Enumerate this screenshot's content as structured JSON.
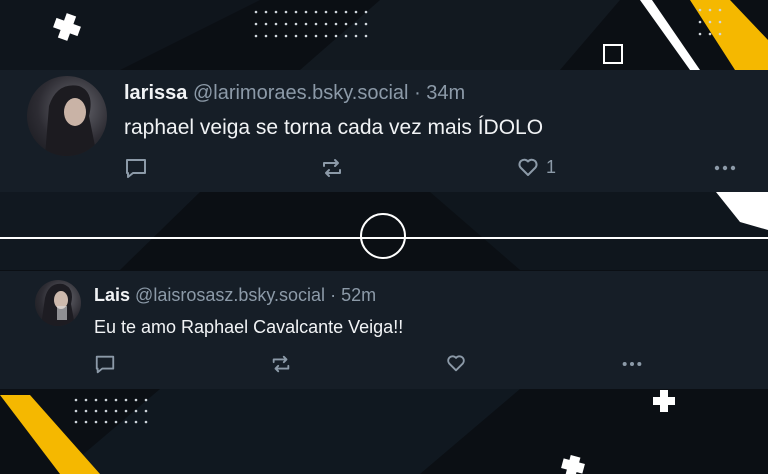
{
  "colors": {
    "background": "#0b0f14",
    "card": "#161e27",
    "accent_yellow": "#f5b800",
    "muted": "#8c9aa8",
    "text": "#f1f3f5"
  },
  "posts": [
    {
      "display_name": "larissa",
      "handle": "@larimoraes.bsky.social",
      "separator": "·",
      "time": "34m",
      "text": "raphael veiga se torna cada vez mais ÍDOLO",
      "like_count": "1",
      "icons": [
        "reply-icon",
        "repost-icon",
        "heart-icon",
        "more-icon"
      ]
    },
    {
      "display_name": "Lais",
      "handle": "@laisrosasz.bsky.social",
      "separator": "·",
      "time": "52m",
      "text": "Eu te amo Raphael Cavalcante Veiga!!",
      "icons": [
        "reply-icon",
        "repost-icon",
        "heart-icon",
        "more-icon"
      ]
    }
  ]
}
